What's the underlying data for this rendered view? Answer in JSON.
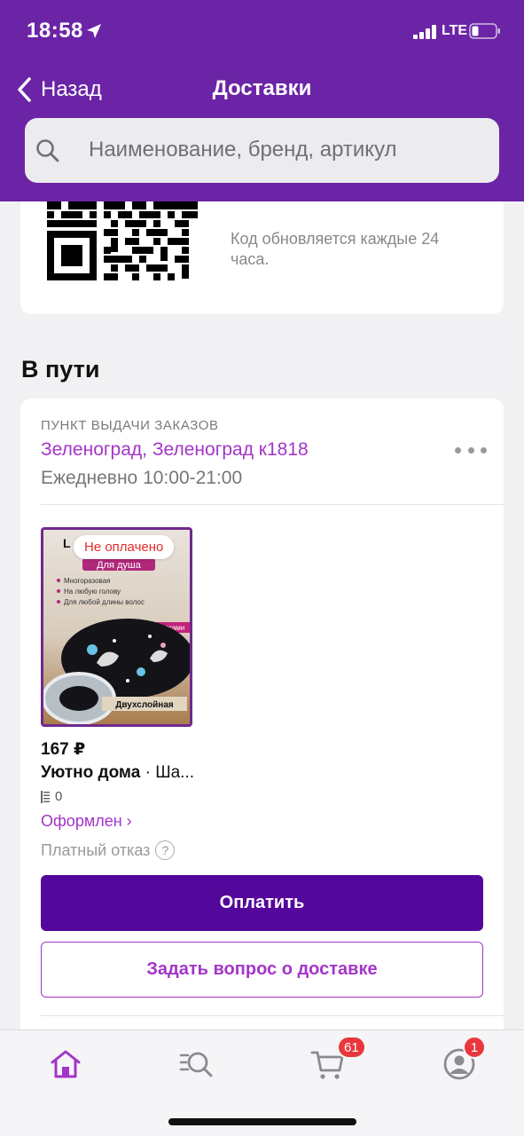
{
  "status_bar": {
    "time": "18:58",
    "network": "LTE"
  },
  "nav": {
    "back_label": "Назад",
    "title": "Доставки"
  },
  "search": {
    "placeholder": "Наименование, бренд, артикул"
  },
  "qr_card": {
    "note": "Код обновляется каждые 24 часа."
  },
  "section": {
    "title": "В пути"
  },
  "delivery": {
    "pickup_label": "ПУНКТ ВЫДАЧИ ЗАКАЗОВ",
    "address": "Зеленоград, Зеленоград к1818",
    "hours": "Ежедневно 10:00-21:00",
    "product": {
      "badge": "Не оплачено",
      "image_text": {
        "top": "Для душа",
        "bullets": [
          "Многоразовая",
          "На любую голову",
          "Для любой длины волос"
        ],
        "tag": "с единорогами",
        "bottom": "Двухслойная"
      },
      "price": "167 ₽",
      "brand": "Уютно дома",
      "name_rest": " · Ша...",
      "quantity": "0",
      "status": "Оформлен ›",
      "refusal": "Платный отказ",
      "help_mark": "?"
    },
    "pay_button": "Оплатить",
    "ask_button": "Задать вопрос о доставке"
  },
  "tabbar": {
    "items": [
      {
        "icon": "home-icon"
      },
      {
        "icon": "catalog-search-icon"
      },
      {
        "icon": "cart-icon",
        "badge": "61"
      },
      {
        "icon": "profile-icon",
        "badge": "1"
      }
    ]
  },
  "colors": {
    "header": "#6b24a6",
    "accent": "#a335c9",
    "primary_button": "#54079b",
    "badge": "#e8383e",
    "unpaid": "#e52b2b"
  }
}
